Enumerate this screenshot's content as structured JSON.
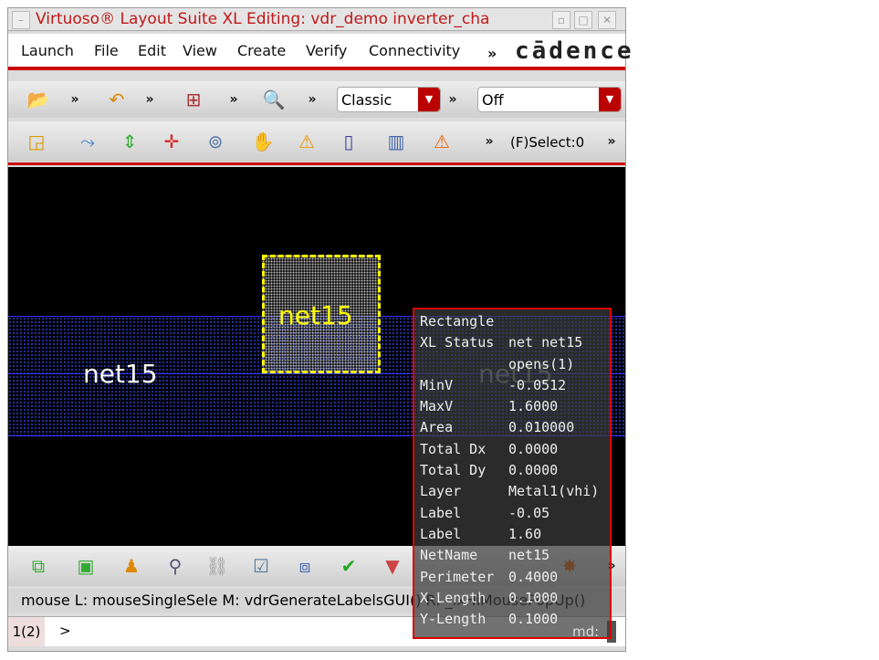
{
  "window": {
    "title": "Virtuoso® Layout Suite XL Editing: vdr_demo inverter_cha",
    "buttons": [
      "▫",
      "□",
      "✕"
    ]
  },
  "menu": {
    "items": [
      "Launch",
      "File",
      "Edit",
      "View",
      "Create",
      "Verify",
      "Connectivity"
    ],
    "overflow": "»",
    "logo": "cādence"
  },
  "toolbar1": {
    "chev": "»",
    "workspace": "Classic",
    "filter": "Off"
  },
  "toolbar2": {
    "chev": "»",
    "select_status": "(F)Select:0"
  },
  "canvas": {
    "labels": [
      "net15",
      "net15",
      "net15"
    ]
  },
  "tooltip": {
    "title": "Rectangle",
    "rows": [
      {
        "k": "XL Status",
        "v": "net net15"
      },
      {
        "k": "",
        "v": "opens(1)"
      },
      {
        "k": "MinV",
        "v": "-0.0512"
      },
      {
        "k": "MaxV",
        "v": "1.6000"
      },
      {
        "k": "Area",
        "v": "0.010000"
      },
      {
        "k": "Total Dx",
        "v": "0.0000"
      },
      {
        "k": "Total Dy",
        "v": "0.0000"
      },
      {
        "k": "Layer",
        "v": "Metal1(vhi)"
      },
      {
        "k": "Label",
        "v": "-0.05"
      },
      {
        "k": "Label",
        "v": "1.60"
      },
      {
        "k": "NetName",
        "v": "net15"
      },
      {
        "k": "Perimeter",
        "v": "0.4000"
      },
      {
        "k": "X-Length",
        "v": "0.1000"
      },
      {
        "k": "Y-Length",
        "v": "0.1000"
      }
    ]
  },
  "status": {
    "text": "mouse L: mouseSingleSele  M: vdrGenerateLabelsGUI()  R: _lxHiMousePopUp()"
  },
  "cmd": {
    "index": "1(2)",
    "prompt": ">",
    "label": "md:"
  },
  "colors": {
    "accent": "#cc0000",
    "selection": "#ffff00",
    "metal": "#3333ff"
  }
}
